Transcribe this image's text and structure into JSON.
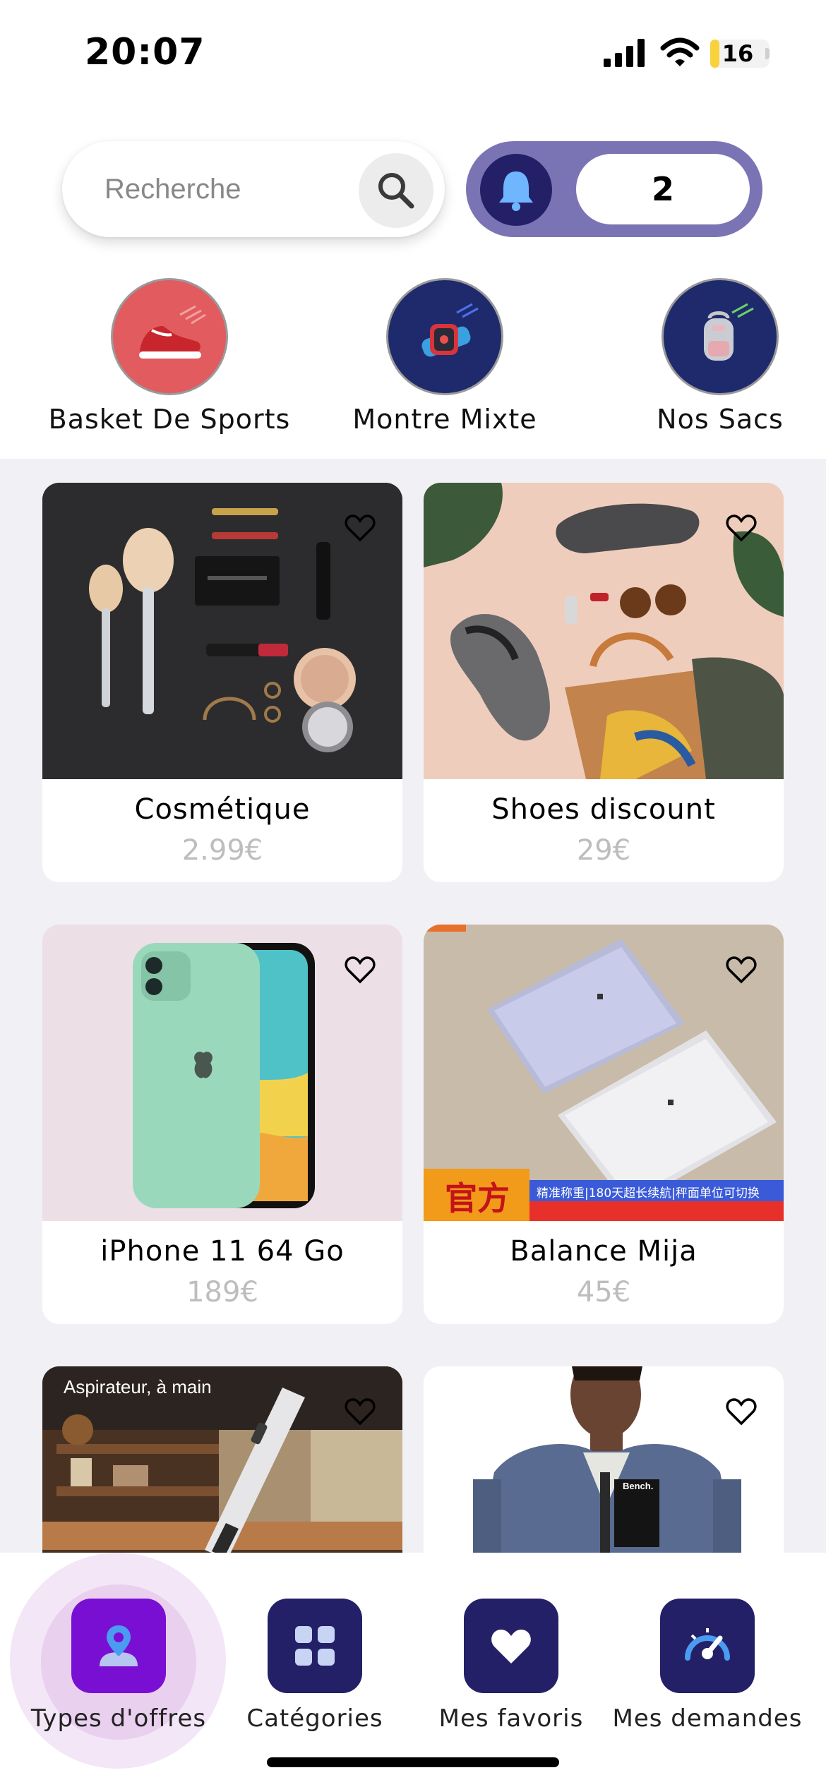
{
  "status_bar": {
    "time": "20:07",
    "battery": "16",
    "battery_level": 0.16
  },
  "search": {
    "placeholder": "Recherche"
  },
  "notifications": {
    "count": "2"
  },
  "stories": [
    {
      "label": "Basket De Sports",
      "icon": "sneaker-icon",
      "color": "#e15b5f"
    },
    {
      "label": "Montre Mixte",
      "icon": "smartwatch-icon",
      "color": "#1e2a6b"
    },
    {
      "label": "Nos Sacs",
      "icon": "backpack-icon",
      "color": "#1e2a6b"
    }
  ],
  "products": [
    {
      "title": "Cosmétique",
      "price": "2.99€"
    },
    {
      "title": "Shoes discount",
      "price": "29€"
    },
    {
      "title": "iPhone 11 64 Go",
      "price": "189€"
    },
    {
      "title": "Balance Mija",
      "price": "45€"
    },
    {
      "title": "",
      "price": "",
      "image_caption": "Aspirateur, à main"
    },
    {
      "title": "",
      "price": "",
      "image_caption": "Bench."
    }
  ],
  "scale_banner": {
    "badge": "官方",
    "tagline": "精准称重|180天超长续航|秤面单位可切换"
  },
  "bottom_nav": [
    {
      "label": "Types d'offres",
      "icon": "map-pin-person-icon",
      "active": true
    },
    {
      "label": "Catégories",
      "icon": "grid-icon",
      "active": false
    },
    {
      "label": "Mes favoris",
      "icon": "heart-icon",
      "active": false
    },
    {
      "label": "Mes demandes",
      "icon": "gauge-icon",
      "active": false
    }
  ],
  "colors": {
    "primary": "#242067",
    "active": "#7a0fd4",
    "pill": "#7b74b4",
    "grid_bg": "#f1f1f5",
    "price": "#bdbdbd"
  }
}
